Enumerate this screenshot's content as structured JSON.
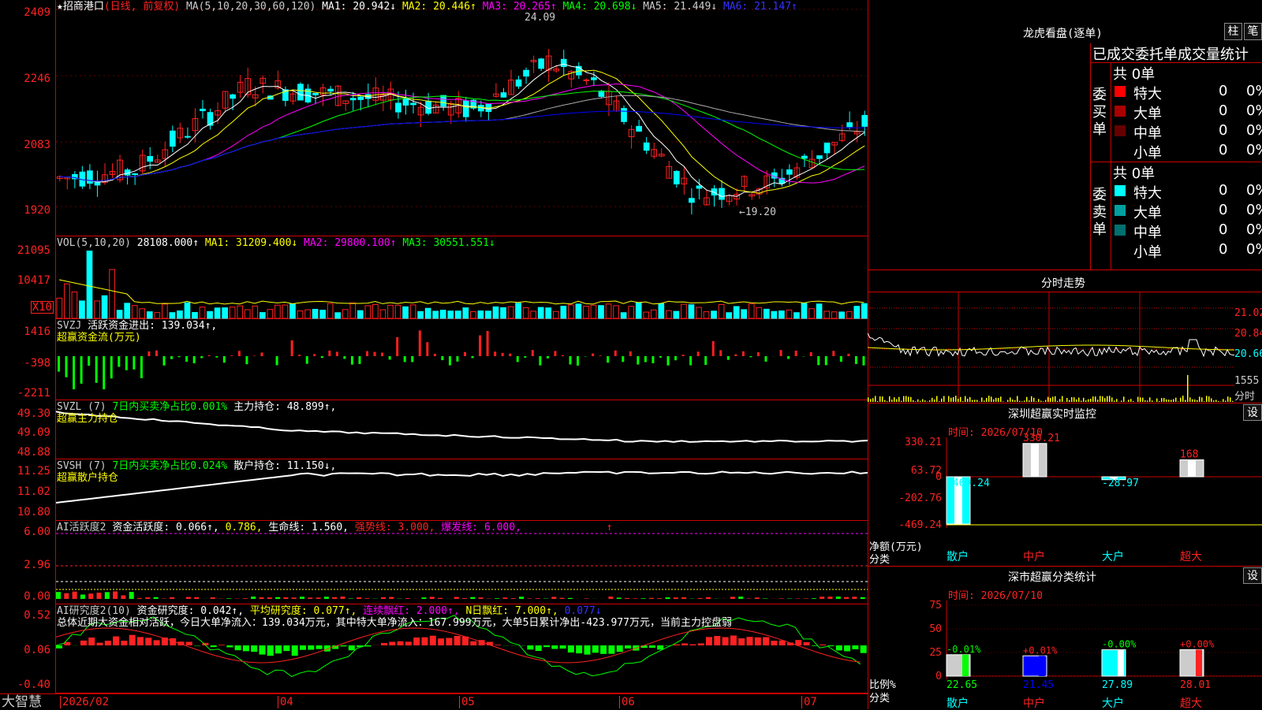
{
  "colors": {
    "up": "#ff2020",
    "down": "#00ffff",
    "ma1": "#ffffff",
    "ma2": "#ffff00",
    "ma3": "#ff00ff",
    "ma4": "#00ff00",
    "ma5": "#aaaaaa",
    "ma6": "#0000ff",
    "grid": "#cc0000"
  },
  "main": {
    "star": "★",
    "stock": "招商港口",
    "period": "(日线, 前复权)",
    "ma_params": "MA(5,10,20,30,60,120)",
    "ma1": "MA1: 20.942↓",
    "ma2": "MA2: 20.446↑",
    "ma3": "MA3: 20.265↑",
    "ma4": "MA4: 20.698↓",
    "ma5": "MA5: 21.449↓",
    "ma6": "MA6: 21.147↑",
    "high_mark": "24.09",
    "low_mark": "←19.20",
    "yticks": [
      "2409",
      "2246",
      "2083",
      "1920"
    ]
  },
  "vol": {
    "name": "VOL(5,10,20)",
    "value": "28108.000↑",
    "ma1": "MA1: 31209.400↓",
    "ma2": "MA2: 29800.100↑",
    "ma3": "MA3: 30551.551↓",
    "yticks": [
      "21095",
      "10417"
    ],
    "unit": "X10"
  },
  "svzj": {
    "name": "SVZJ",
    "label": "活跃资金进出: 139.034↑,",
    "sub": "超赢资金流(万元)",
    "yticks": [
      "1416",
      "-398",
      "-2211"
    ]
  },
  "svzl": {
    "name": "SVZL (7)",
    "ratio": "7日内买卖净占比0.001%",
    "hold": "主力持仓: 48.899↑,",
    "sub": "超赢主力持仓",
    "yticks": [
      "49.30",
      "49.09",
      "48.88"
    ]
  },
  "svsh": {
    "name": "SVSH (7)",
    "ratio": "7日内买卖净占比0.024%",
    "hold": "散户持仓: 11.150↓,",
    "sub": "超赢散户持仓",
    "yticks": [
      "11.25",
      "11.02",
      "10.80"
    ]
  },
  "ai1": {
    "name": "AI活跃度2",
    "a": "资金活跃度: 0.066↑,",
    "b": "0.786,",
    "c": "生命线: 1.560,",
    "d": "强势线: 3.000,",
    "e": "爆发线: 6.000,",
    "arrow": "↑",
    "yticks": [
      "6.00",
      "2.96",
      "0.00"
    ]
  },
  "ai2": {
    "name": "AI研究度2(10)",
    "a": "资金研究度: 0.042↑,",
    "b": "平均研究度: 0.077↑,",
    "c": "连续飘红: 2.000↑,",
    "d": "N日飘红: 7.000↑,",
    "e": "0.077↓",
    "summary": "总体近期大资金相对活跃，今日大单净流入：139.034万元，其中特大单净流入：167.999万元，大单5日累计净出-423.977万元，当前主力控盘弱",
    "yticks": [
      "0.52",
      "0.06",
      "-0.40"
    ]
  },
  "footer": {
    "brand": "大智慧",
    "dates": [
      "2026/02",
      "04",
      "05",
      "06",
      "07"
    ]
  },
  "lhb": {
    "title": "龙虎看盘(逐单)",
    "btn1": "柱",
    "btn2": "笔",
    "subtitle": "已成交委托单成交量统计",
    "buy_label": "委买单",
    "sell_label": "委卖单",
    "buy": {
      "total": "共 0单",
      "rows": [
        {
          "name": "特大",
          "v": "0",
          "p": "0%",
          "c": "#ff0000"
        },
        {
          "name": "大单",
          "v": "0",
          "p": "0%",
          "c": "#aa0000"
        },
        {
          "name": "中单",
          "v": "0",
          "p": "0%",
          "c": "#660000"
        },
        {
          "name": "小单",
          "v": "0",
          "p": "0%",
          "c": ""
        }
      ]
    },
    "sell": {
      "total": "共 0单",
      "rows": [
        {
          "name": "特大",
          "v": "0",
          "p": "0%",
          "c": "#00ffff"
        },
        {
          "name": "大单",
          "v": "0",
          "p": "0%",
          "c": "#00a0a0"
        },
        {
          "name": "中单",
          "v": "0",
          "p": "0%",
          "c": "#007070"
        },
        {
          "name": "小单",
          "v": "0",
          "p": "0%",
          "c": ""
        }
      ]
    }
  },
  "fenshi": {
    "title": "分时走势",
    "yticks": [
      "21.02",
      "20.84",
      "20.66"
    ],
    "vol": "1555",
    "vlabel": "分时"
  },
  "sz_monitor": {
    "title": "深圳超赢实时监控",
    "btn": "设",
    "time": "时间: 2026/07/10",
    "yticks": [
      "330.21",
      "63.72",
      "0",
      "-202.76",
      "-469.24"
    ],
    "ylabel": "净额(万元)",
    "xlabel": "分类",
    "cats": [
      "散户",
      "中户",
      "大户",
      "超大"
    ],
    "vals": [
      -469.24,
      330.21,
      -28.97,
      168
    ],
    "labels": [
      "-469.24",
      "330.21",
      "-28.97",
      "168"
    ]
  },
  "sz_stat": {
    "title": "深市超赢分类统计",
    "btn": "设",
    "time": "时间: 2026/07/10",
    "yticks": [
      "75",
      "50",
      "25",
      "0"
    ],
    "ylabel": "比例%",
    "xlabel": "分类",
    "cats": [
      "散户",
      "中户",
      "大户",
      "超大"
    ],
    "vals": [
      22.65,
      21.45,
      27.89,
      28.01
    ],
    "top": [
      "-0.01%",
      "+0.01%",
      "-0.00%",
      "+0.00%"
    ],
    "bottom": [
      "22.65",
      "21.45",
      "27.89",
      "28.01"
    ]
  }
}
